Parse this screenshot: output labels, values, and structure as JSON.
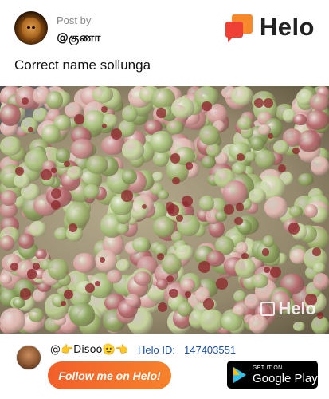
{
  "header": {
    "post_by_label": "Post by",
    "username": "@குணா"
  },
  "brand": {
    "name": "Helo",
    "colors": {
      "orange": "#f8892a",
      "red": "#ef4035"
    }
  },
  "post": {
    "caption": "Correct name sollunga",
    "image_subject": "pile of manila tamarind pods (kodukkapuli)",
    "watermark": "Helo"
  },
  "footer": {
    "username": "@👉Disoo🫡👈",
    "helo_id_label": "Helo ID:",
    "helo_id_value": "147403551",
    "follow_button": "Follow me on Helo!",
    "store_badge": {
      "small": "GET IT ON",
      "big": "Google Play"
    }
  },
  "colors": {
    "follow_button": "#f46f2b",
    "helo_id": "#1d4fa1"
  }
}
